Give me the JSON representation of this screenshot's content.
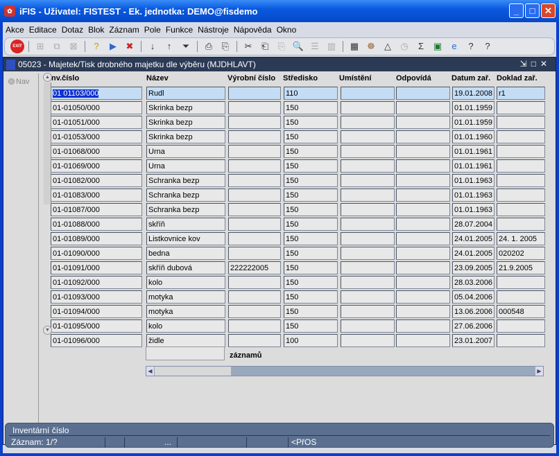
{
  "window": {
    "title": "iFIS - Uživatel: FISTEST - Ek. jednotka: DEMO@fisdemo"
  },
  "menu": [
    "Akce",
    "Editace",
    "Dotaz",
    "Blok",
    "Záznam",
    "Pole",
    "Funkce",
    "Nástroje",
    "Nápověda",
    "Okno"
  ],
  "toolbar": {
    "exit_label": "EXIT"
  },
  "form": {
    "title": "05023 - Majetek/Tisk drobného majetku dle výběru (MJDHLAVT)",
    "nav_label": "Nav",
    "columns": [
      "Inv.číslo",
      "Název",
      "Výrobní číslo",
      "Středisko",
      "Umístění",
      "Odpovídá",
      "Datum zař.",
      "Doklad zař."
    ],
    "rows": [
      [
        "01 01103/000",
        "Rudl",
        "",
        "110",
        "",
        "",
        "19.01.2008",
        "r1"
      ],
      [
        "01-01050/000",
        "Skrinka bezp",
        "",
        "150",
        "",
        "",
        "01.01.1959",
        ""
      ],
      [
        "01-01051/000",
        "Skrinka bezp",
        "",
        "150",
        "",
        "",
        "01.01.1959",
        ""
      ],
      [
        "01-01053/000",
        "Skrinka bezp",
        "",
        "150",
        "",
        "",
        "01.01.1960",
        ""
      ],
      [
        "01-01068/000",
        "Urna",
        "",
        "150",
        "",
        "",
        "01.01.1961",
        ""
      ],
      [
        "01-01069/000",
        "Urna",
        "",
        "150",
        "",
        "",
        "01.01.1961",
        ""
      ],
      [
        "01-01082/000",
        "Schranka bezp",
        "",
        "150",
        "",
        "",
        "01.01.1963",
        ""
      ],
      [
        "01-01083/000",
        "Schranka bezp",
        "",
        "150",
        "",
        "",
        "01.01.1963",
        ""
      ],
      [
        "01-01087/000",
        "Schranka bezp",
        "",
        "150",
        "",
        "",
        "01.01.1963",
        ""
      ],
      [
        "01-01088/000",
        "skříň",
        "",
        "150",
        "",
        "",
        "28.07.2004",
        ""
      ],
      [
        "01-01089/000",
        "Listkovnice kov",
        "",
        "150",
        "",
        "",
        "24.01.2005",
        "24. 1. 2005"
      ],
      [
        "01-01090/000",
        "bedna",
        "",
        "150",
        "",
        "",
        "24.01.2005",
        "020202"
      ],
      [
        "01-01091/000",
        "skříň dubová",
        "222222005",
        "150",
        "",
        "",
        "23.09.2005",
        "21.9.2005"
      ],
      [
        "01-01092/000",
        "kolo",
        "",
        "150",
        "",
        "",
        "28.03.2006",
        ""
      ],
      [
        "01-01093/000",
        "motyka",
        "",
        "150",
        "",
        "",
        "05.04.2006",
        ""
      ],
      [
        "01-01094/000",
        "motyka",
        "",
        "150",
        "",
        "",
        "13.06.2006",
        "000548"
      ],
      [
        "01-01095/000",
        "kolo",
        "",
        "150",
        "",
        "",
        "27.06.2006",
        ""
      ],
      [
        "01-01096/000",
        "židle",
        "",
        "100",
        "",
        "",
        "23.01.2007",
        ""
      ]
    ],
    "total_value": "",
    "total_label": "záznamů"
  },
  "status": {
    "hint": "Inventární číslo",
    "record": "Záznam: 1/?",
    "ellipsis": "...",
    "mode": "<PřOS"
  }
}
